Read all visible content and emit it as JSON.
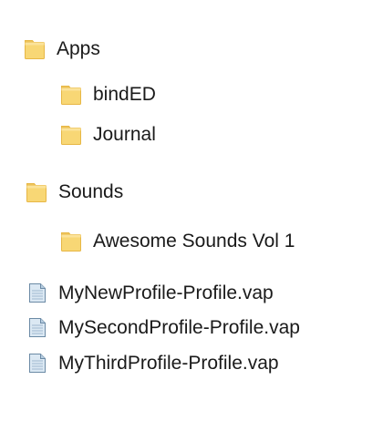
{
  "tree": {
    "folders": [
      {
        "label": "Apps",
        "icon": "folder-icon"
      },
      {
        "label": "bindED",
        "icon": "folder-icon"
      },
      {
        "label": "Journal",
        "icon": "folder-icon"
      },
      {
        "label": "Sounds",
        "icon": "folder-icon"
      },
      {
        "label": "Awesome Sounds Vol 1",
        "icon": "folder-icon"
      }
    ],
    "files": [
      {
        "label": "MyNewProfile-Profile.vap",
        "icon": "file-icon"
      },
      {
        "label": "MySecondProfile-Profile.vap",
        "icon": "file-icon"
      },
      {
        "label": "MyThirdProfile-Profile.vap",
        "icon": "file-icon"
      }
    ]
  },
  "colors": {
    "folder": "#f8d775",
    "folder_border": "#e7b745",
    "file": "#c9dcec",
    "file_border": "#6b8aa5",
    "text": "#1a1a1a"
  }
}
